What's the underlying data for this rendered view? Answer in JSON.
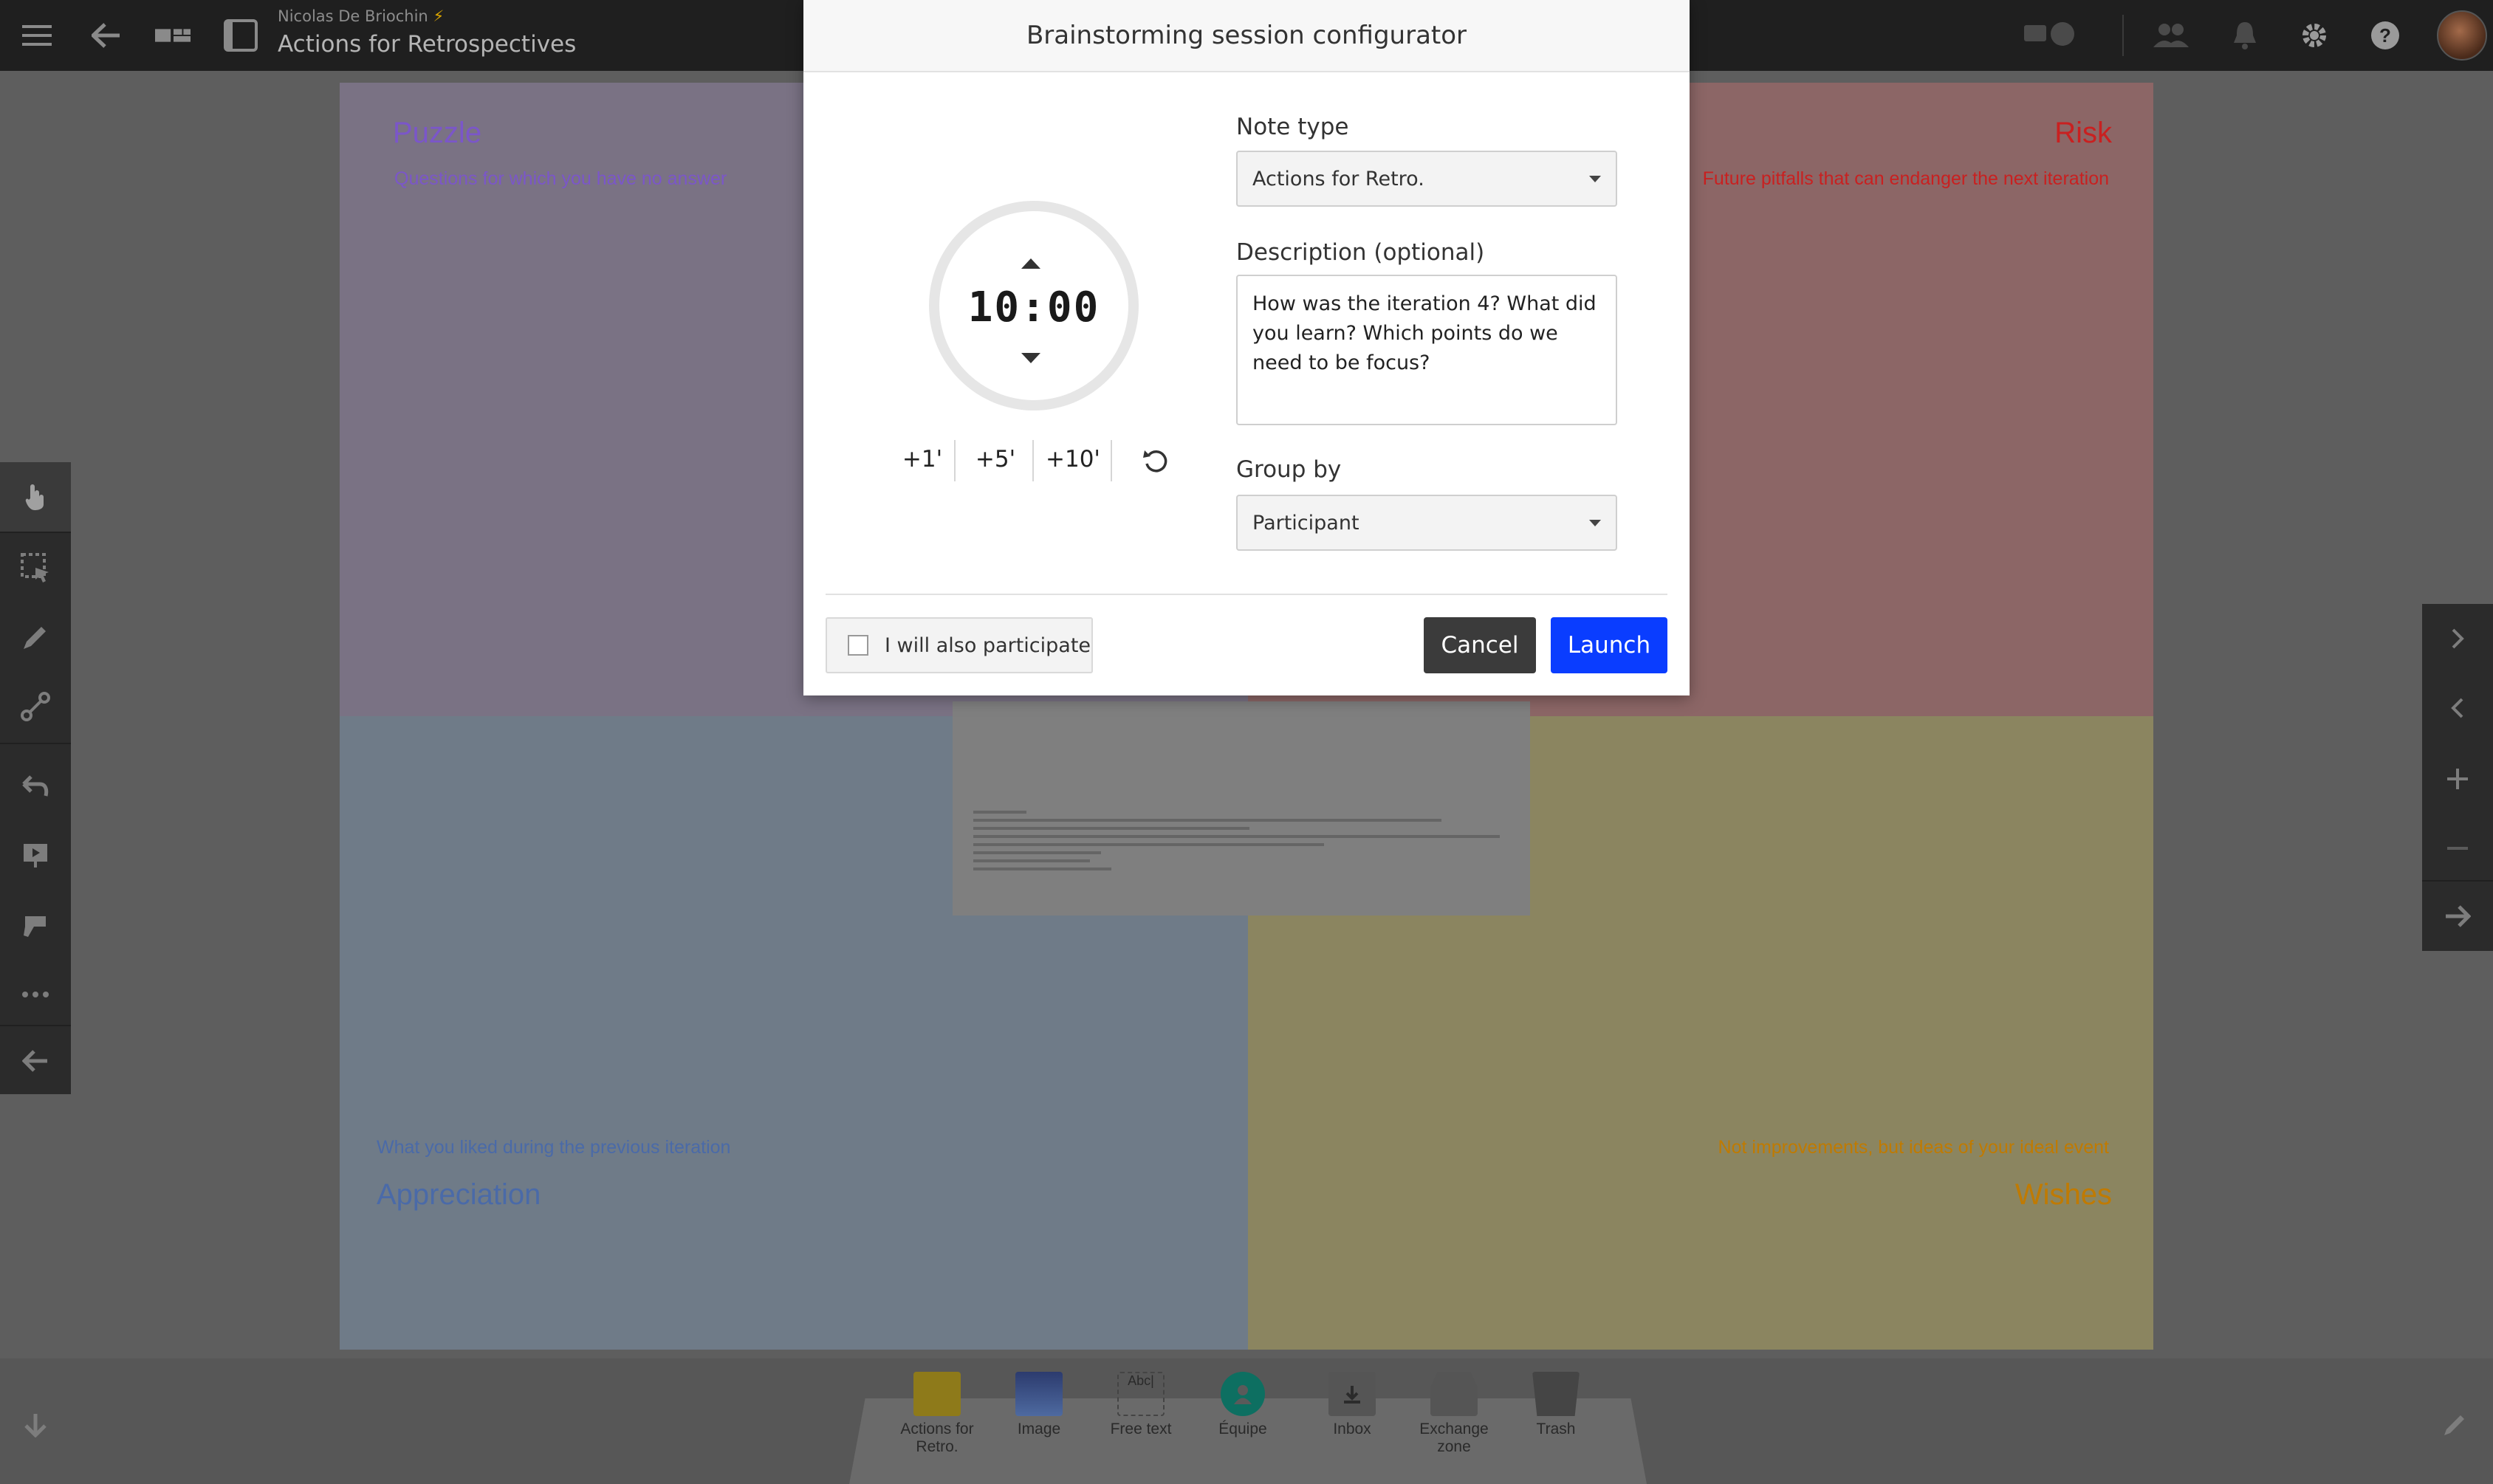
{
  "header": {
    "user": "Nicolas De Briochin",
    "user_badge": "⚡",
    "board_title": "Actions for Retrospectives"
  },
  "board": {
    "quadrants": {
      "puzzle": {
        "title": "Puzzle",
        "subtitle": "Questions for which you have no answer",
        "title_color": "#7b56c9"
      },
      "risk": {
        "title": "Risk",
        "subtitle": "Future pitfalls that can endanger the next iteration",
        "title_color": "#c92020"
      },
      "appreciation": {
        "title": "Appreciation",
        "subtitle": "What you liked during the previous iteration",
        "title_color": "#4a6aa8"
      },
      "wishes": {
        "title": "Wishes",
        "subtitle": "Not improvements, but ideas of your ideal event",
        "title_color": "#c07a00"
      }
    }
  },
  "dialog": {
    "title": "Brainstorming session configurator",
    "timer": {
      "minutes": "10",
      "separator": ":",
      "seconds": "00"
    },
    "quick_add": [
      "+1'",
      "+5'",
      "+10'"
    ],
    "note_type": {
      "label": "Note type",
      "value": "Actions for Retro."
    },
    "description": {
      "label": "Description (optional)",
      "value": "How was the iteration 4? What did you learn? Which points do we need to be focus?"
    },
    "group_by": {
      "label": "Group by",
      "value": "Participant"
    },
    "participate_label": "I will also participate",
    "participate_checked": false,
    "cancel_label": "Cancel",
    "launch_label": "Launch",
    "accent_color": "#0a3dff"
  },
  "tray": {
    "items": [
      {
        "label": "Actions for Retro.",
        "icon": "sticky-note-icon"
      },
      {
        "label": "Image",
        "icon": "image-icon"
      },
      {
        "label": "Free text",
        "icon": "free-text-icon",
        "icon_text": "Abc|"
      },
      {
        "label": "Équipe",
        "icon": "team-icon"
      },
      {
        "label": "Inbox",
        "icon": "inbox-icon"
      },
      {
        "label": "Exchange zone",
        "icon": "exchange-zone-icon"
      },
      {
        "label": "Trash",
        "icon": "trash-icon"
      }
    ]
  }
}
